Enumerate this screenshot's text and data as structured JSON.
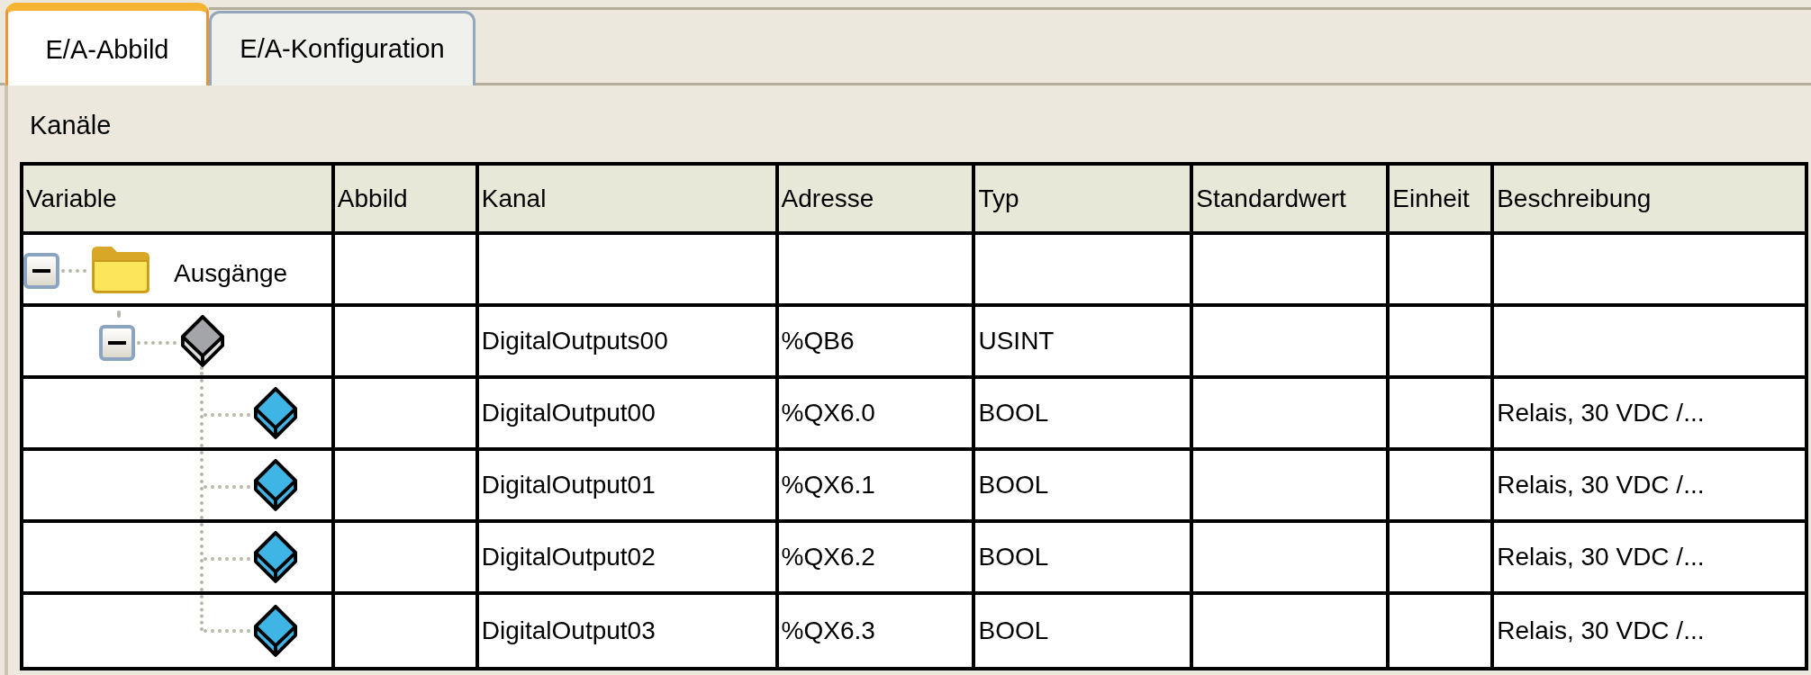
{
  "tabs": [
    {
      "label": "E/A-Abbild",
      "selected": true
    },
    {
      "label": "E/A-Konfiguration",
      "selected": false
    }
  ],
  "section_title": "Kanäle",
  "table": {
    "columns": [
      "Variable",
      "Abbild",
      "Kanal",
      "Adresse",
      "Typ",
      "Standardwert",
      "Einheit",
      "Beschreibung"
    ],
    "rows": [
      {
        "kind": "folder",
        "variable": "Ausgänge",
        "expanded": true,
        "children": [
          {
            "kind": "channel",
            "kanal": "DigitalOutputs00",
            "adresse": "%QB6",
            "typ": "USINT",
            "expanded": true,
            "children": [
              {
                "kind": "bit",
                "kanal": "DigitalOutput00",
                "adresse": "%QX6.0",
                "typ": "BOOL",
                "beschreibung": "Relais, 30 VDC /..."
              },
              {
                "kind": "bit",
                "kanal": "DigitalOutput01",
                "adresse": "%QX6.1",
                "typ": "BOOL",
                "beschreibung": "Relais, 30 VDC /..."
              },
              {
                "kind": "bit",
                "kanal": "DigitalOutput02",
                "adresse": "%QX6.2",
                "typ": "BOOL",
                "beschreibung": "Relais, 30 VDC /..."
              },
              {
                "kind": "bit",
                "kanal": "DigitalOutput03",
                "adresse": "%QX6.3",
                "typ": "BOOL",
                "beschreibung": "Relais, 30 VDC /..."
              }
            ]
          }
        ]
      }
    ]
  }
}
